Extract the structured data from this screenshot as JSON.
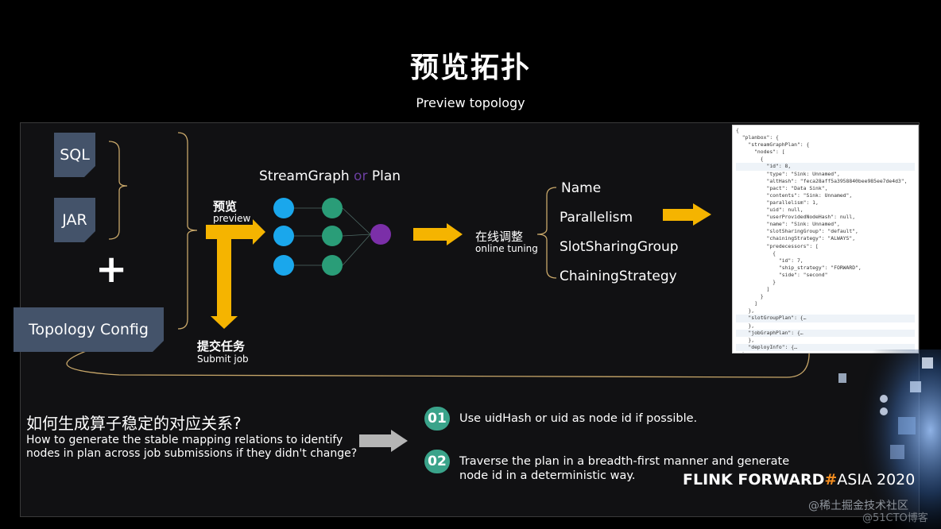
{
  "header": {
    "title": "预览拓扑",
    "subtitle": "Preview topology"
  },
  "inputs": {
    "sql_label": "SQL",
    "jar_label": "JAR",
    "plus_symbol": "+",
    "topology_config_label": "Topology Config"
  },
  "flow": {
    "preview_cn": "预览",
    "preview_en": "preview",
    "submit_cn": "提交任务",
    "submit_en": "Submit job",
    "graph_title_a": "StreamGraph",
    "graph_title_or": " or ",
    "graph_title_b": "Plan",
    "tuning_cn": "在线调整",
    "tuning_en": "online tuning",
    "properties": [
      "Name",
      "Parallelism",
      "SlotSharingGroup",
      "ChainingStrategy"
    ]
  },
  "graph": {
    "layers": [
      {
        "count": 3,
        "color": "#1aa7ec"
      },
      {
        "count": 3,
        "color": "#2a9d78"
      },
      {
        "count": 1,
        "color": "#7b2fa8"
      }
    ]
  },
  "colors": {
    "arrow_yellow": "#f5b400",
    "bracket": "#c9a86a",
    "badge_green": "#3aa38a",
    "brand_hash": "#f28c1f",
    "card_bg": "#44536a"
  },
  "json_snippet": [
    "{",
    "  \"planbox\": {",
    "    \"streamGraphPlan\": {",
    "      \"nodes\": [",
    "        {",
    "          \"id\": 8,",
    "          \"type\": \"Sink: Unnamed\",",
    "          \"altHash\": \"feca28aff5a3958840bee985ee7de4d3\",",
    "          \"pact\": \"Data Sink\",",
    "          \"contents\": \"Sink: Unnamed\",",
    "          \"parallelism\": 1,",
    "          \"uid\": null,",
    "          \"userProvidedNodeHash\": null,",
    "          \"name\": \"Sink: Unnamed\",",
    "          \"slotSharingGroup\": \"default\",",
    "          \"chainingStrategy\": \"ALWAYS\",",
    "          \"predecessors\": [",
    "            {",
    "              \"id\": 7,",
    "              \"ship_strategy\": \"FORWARD\",",
    "              \"side\": \"second\"",
    "            }",
    "          ]",
    "        }",
    "      ]",
    "    },",
    "    \"slotGroupPlan\": {…",
    "    },",
    "    \"jobGraphPlan\": {…",
    "    },",
    "    \"deployInfo\": {…",
    "  }"
  ],
  "question": {
    "cn": "如何生成算子稳定的对应关系?",
    "en": "How to generate the stable mapping relations to identify nodes in plan across job submissions if they didn't change?"
  },
  "answers": [
    {
      "num": "01",
      "text": "Use uidHash or uid as node id if possible."
    },
    {
      "num": "02",
      "text": "Traverse the plan in a breadth-first manner and generate node id in a deterministic way."
    }
  ],
  "branding": {
    "part1": "FLINK FORWARD",
    "hash": "#",
    "part2": "ASIA 2020"
  },
  "watermarks": [
    "@稀土掘金技术社区",
    "@51CTO博客"
  ]
}
